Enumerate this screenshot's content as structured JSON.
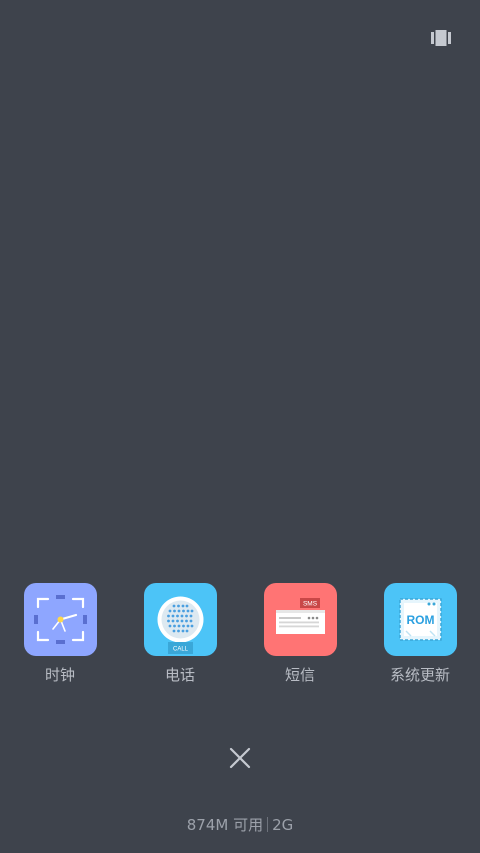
{
  "header": {
    "view_toggle_icon": "card-view-icon"
  },
  "dock": {
    "apps": [
      {
        "label": "时钟",
        "icon": "clock-icon",
        "color": "#8ea6ff"
      },
      {
        "label": "电话",
        "icon": "phone-icon",
        "color": "#4cc4f7",
        "icon_text": "CALL"
      },
      {
        "label": "短信",
        "icon": "sms-icon",
        "color": "#ff7474",
        "icon_text": "SMS"
      },
      {
        "label": "系统更新",
        "icon": "system-update-icon",
        "color": "#4cc4f7",
        "icon_text": "ROM"
      }
    ]
  },
  "close_button": {
    "icon": "close-icon"
  },
  "memory": {
    "available": "874M 可用",
    "total": "2G"
  }
}
